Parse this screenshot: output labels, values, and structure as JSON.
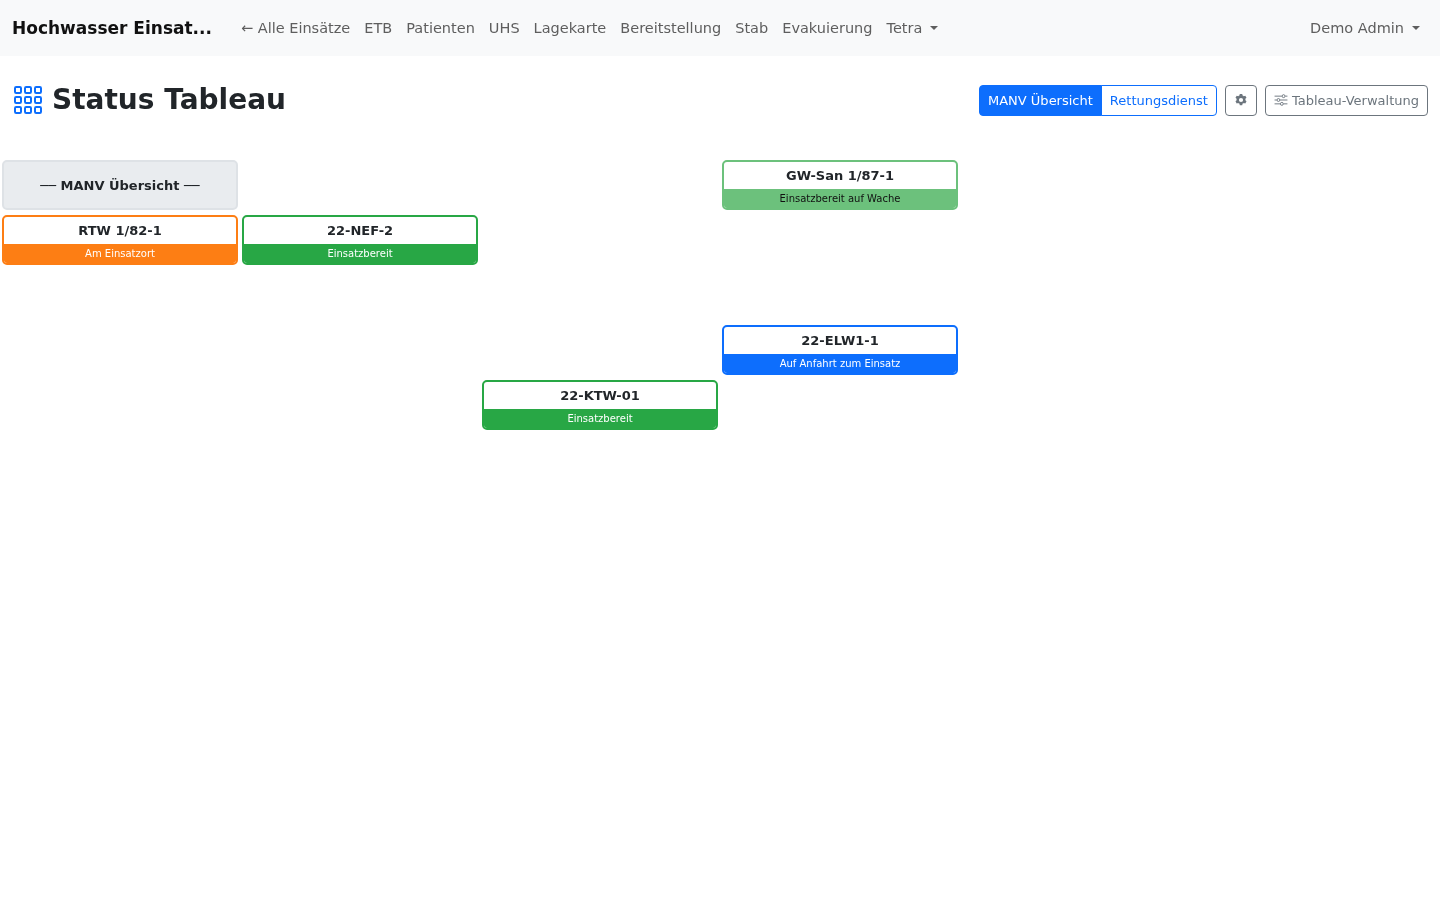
{
  "navbar": {
    "brand": "Hochwasser Einsat...",
    "links": [
      {
        "label": "← Alle Einsätze",
        "kind": "link"
      },
      {
        "label": "ETB",
        "kind": "link"
      },
      {
        "label": "Patienten",
        "kind": "link"
      },
      {
        "label": "UHS",
        "kind": "link"
      },
      {
        "label": "Lagekarte",
        "kind": "link"
      },
      {
        "label": "Bereitstellung",
        "kind": "link"
      },
      {
        "label": "Stab",
        "kind": "link"
      },
      {
        "label": "Evakuierung",
        "kind": "link"
      },
      {
        "label": "Tetra",
        "kind": "dropdown"
      }
    ],
    "user": "Demo Admin"
  },
  "page": {
    "title": "Status Tableau",
    "views": [
      {
        "label": "MANV Übersicht",
        "selected": true
      },
      {
        "label": "Rettungsdienst",
        "selected": false
      }
    ],
    "manage_button": "Tableau-Verwaltung"
  },
  "grid": {
    "rows": [
      {
        "cells": [
          {
            "kind": "header",
            "label": "── MANV Übersicht ──"
          },
          {
            "kind": "empty"
          },
          {
            "kind": "empty"
          },
          {
            "kind": "vehicle",
            "name": "GW-San 1/87-1",
            "status": "Einsatzbereit auf Wache",
            "color": "#6cc17c"
          }
        ]
      },
      {
        "cells": [
          {
            "kind": "vehicle",
            "name": "RTW 1/82-1",
            "status": "Am Einsatzort",
            "color": "#fd7e14"
          },
          {
            "kind": "vehicle",
            "name": "22-NEF-2",
            "status": "Einsatzbereit",
            "color": "#28a745"
          }
        ]
      },
      {
        "cells": [
          {
            "kind": "empty"
          }
        ]
      },
      {
        "cells": [
          {
            "kind": "empty"
          },
          {
            "kind": "empty"
          },
          {
            "kind": "empty"
          },
          {
            "kind": "vehicle",
            "name": "22-ELW1-1",
            "status": "Auf Anfahrt zum Einsatz",
            "color": "#0d6efd"
          }
        ]
      },
      {
        "cells": [
          {
            "kind": "empty"
          },
          {
            "kind": "empty"
          },
          {
            "kind": "vehicle",
            "name": "22-KTW-01",
            "status": "Einsatzbereit",
            "color": "#28a745"
          }
        ]
      }
    ]
  }
}
